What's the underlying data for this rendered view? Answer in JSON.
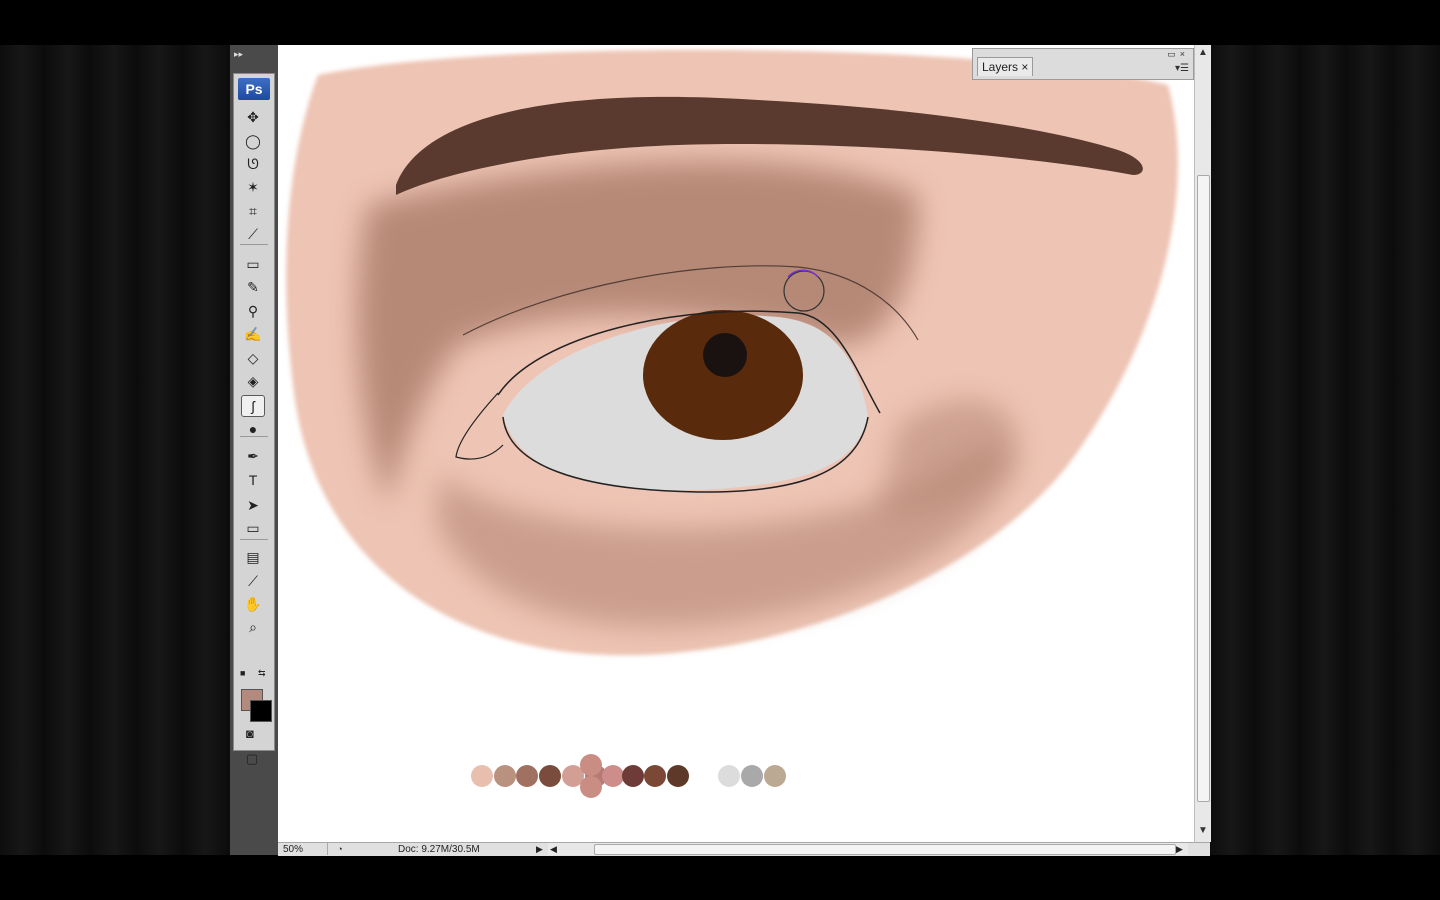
{
  "app": {
    "name": "Ps"
  },
  "toolbox": {
    "grip": "▸▸",
    "tools": [
      {
        "name": "move-tool",
        "icon": "move-icon",
        "glyph": "✥"
      },
      {
        "name": "marquee-tool",
        "icon": "ellipse-marquee-icon",
        "glyph": "◯"
      },
      {
        "name": "lasso-tool",
        "icon": "lasso-icon",
        "glyph": "ᘎ"
      },
      {
        "name": "magic-wand-tool",
        "icon": "magic-wand-icon",
        "glyph": "✶"
      },
      {
        "name": "crop-tool",
        "icon": "crop-icon",
        "glyph": "⌗"
      },
      {
        "name": "eyedropper-tool",
        "icon": "eyedropper-icon",
        "glyph": "⟋"
      },
      {
        "name": "healing-brush-tool",
        "icon": "bandage-icon",
        "glyph": "▭"
      },
      {
        "name": "brush-tool",
        "icon": "brush-icon",
        "glyph": "✎"
      },
      {
        "name": "clone-stamp-tool",
        "icon": "stamp-icon",
        "glyph": "⚲"
      },
      {
        "name": "history-brush-tool",
        "icon": "history-brush-icon",
        "glyph": "✍"
      },
      {
        "name": "eraser-tool",
        "icon": "eraser-icon",
        "glyph": "◇"
      },
      {
        "name": "paint-bucket-tool",
        "icon": "paint-bucket-icon",
        "glyph": "◈"
      },
      {
        "name": "smudge-tool",
        "icon": "smudge-finger-icon",
        "glyph": "ʃ"
      },
      {
        "name": "dodge-tool",
        "icon": "dodge-icon",
        "glyph": "●"
      },
      {
        "name": "pen-tool",
        "icon": "pen-icon",
        "glyph": "✒"
      },
      {
        "name": "type-tool",
        "icon": "type-icon",
        "glyph": "T"
      },
      {
        "name": "path-selection-tool",
        "icon": "arrow-selection-icon",
        "glyph": "➤"
      },
      {
        "name": "shape-tool",
        "icon": "rectangle-shape-icon",
        "glyph": "▭"
      },
      {
        "name": "notes-tool",
        "icon": "note-icon",
        "glyph": "▤"
      },
      {
        "name": "color-sampler-tool",
        "icon": "pipette-icon",
        "glyph": "⟋"
      },
      {
        "name": "hand-tool",
        "icon": "hand-icon",
        "glyph": "✋"
      },
      {
        "name": "zoom-tool",
        "icon": "magnifier-icon",
        "glyph": "⌕"
      }
    ],
    "active_tool": "smudge-tool",
    "foreground_color": "#b58a7e",
    "background_color": "#000000",
    "quick_mask_glyph": "◙",
    "screen_mode_glyph": "▢"
  },
  "canvas": {
    "palette": {
      "skin_swatches": [
        "#e8bfae",
        "#b9917f",
        "#a07060",
        "#7a4c3e",
        "#d39f94",
        "#b57a77",
        "#cd8d8b",
        "#6e3b38",
        "#7a4834",
        "#5e3828"
      ],
      "gray_swatches": [
        "#dcdcdc",
        "#a9a9a9",
        "#bba993"
      ],
      "cluster_swatches": [
        "#c98d84",
        "#c98d84"
      ]
    },
    "colors": {
      "skin": "#eec4b4",
      "shadow": "#ad7f6d",
      "brow": "#5a3a2e",
      "iris": "#5a2a0c",
      "pupil": "#1a1210",
      "sclera": "#dcdcdc"
    }
  },
  "layers_panel": {
    "tab_label": "Layers",
    "close_glyph": "×",
    "window_buttons": "▭×",
    "menu_glyph": "▾☰"
  },
  "statusbar": {
    "zoom": "50%",
    "doc_info": "Doc: 9.27M/30.5M",
    "nav_arrow": "▶",
    "icon_glyph": "◔"
  },
  "scrollbars": {
    "up": "▲",
    "down": "▼",
    "left": "◀",
    "right": "▶"
  }
}
